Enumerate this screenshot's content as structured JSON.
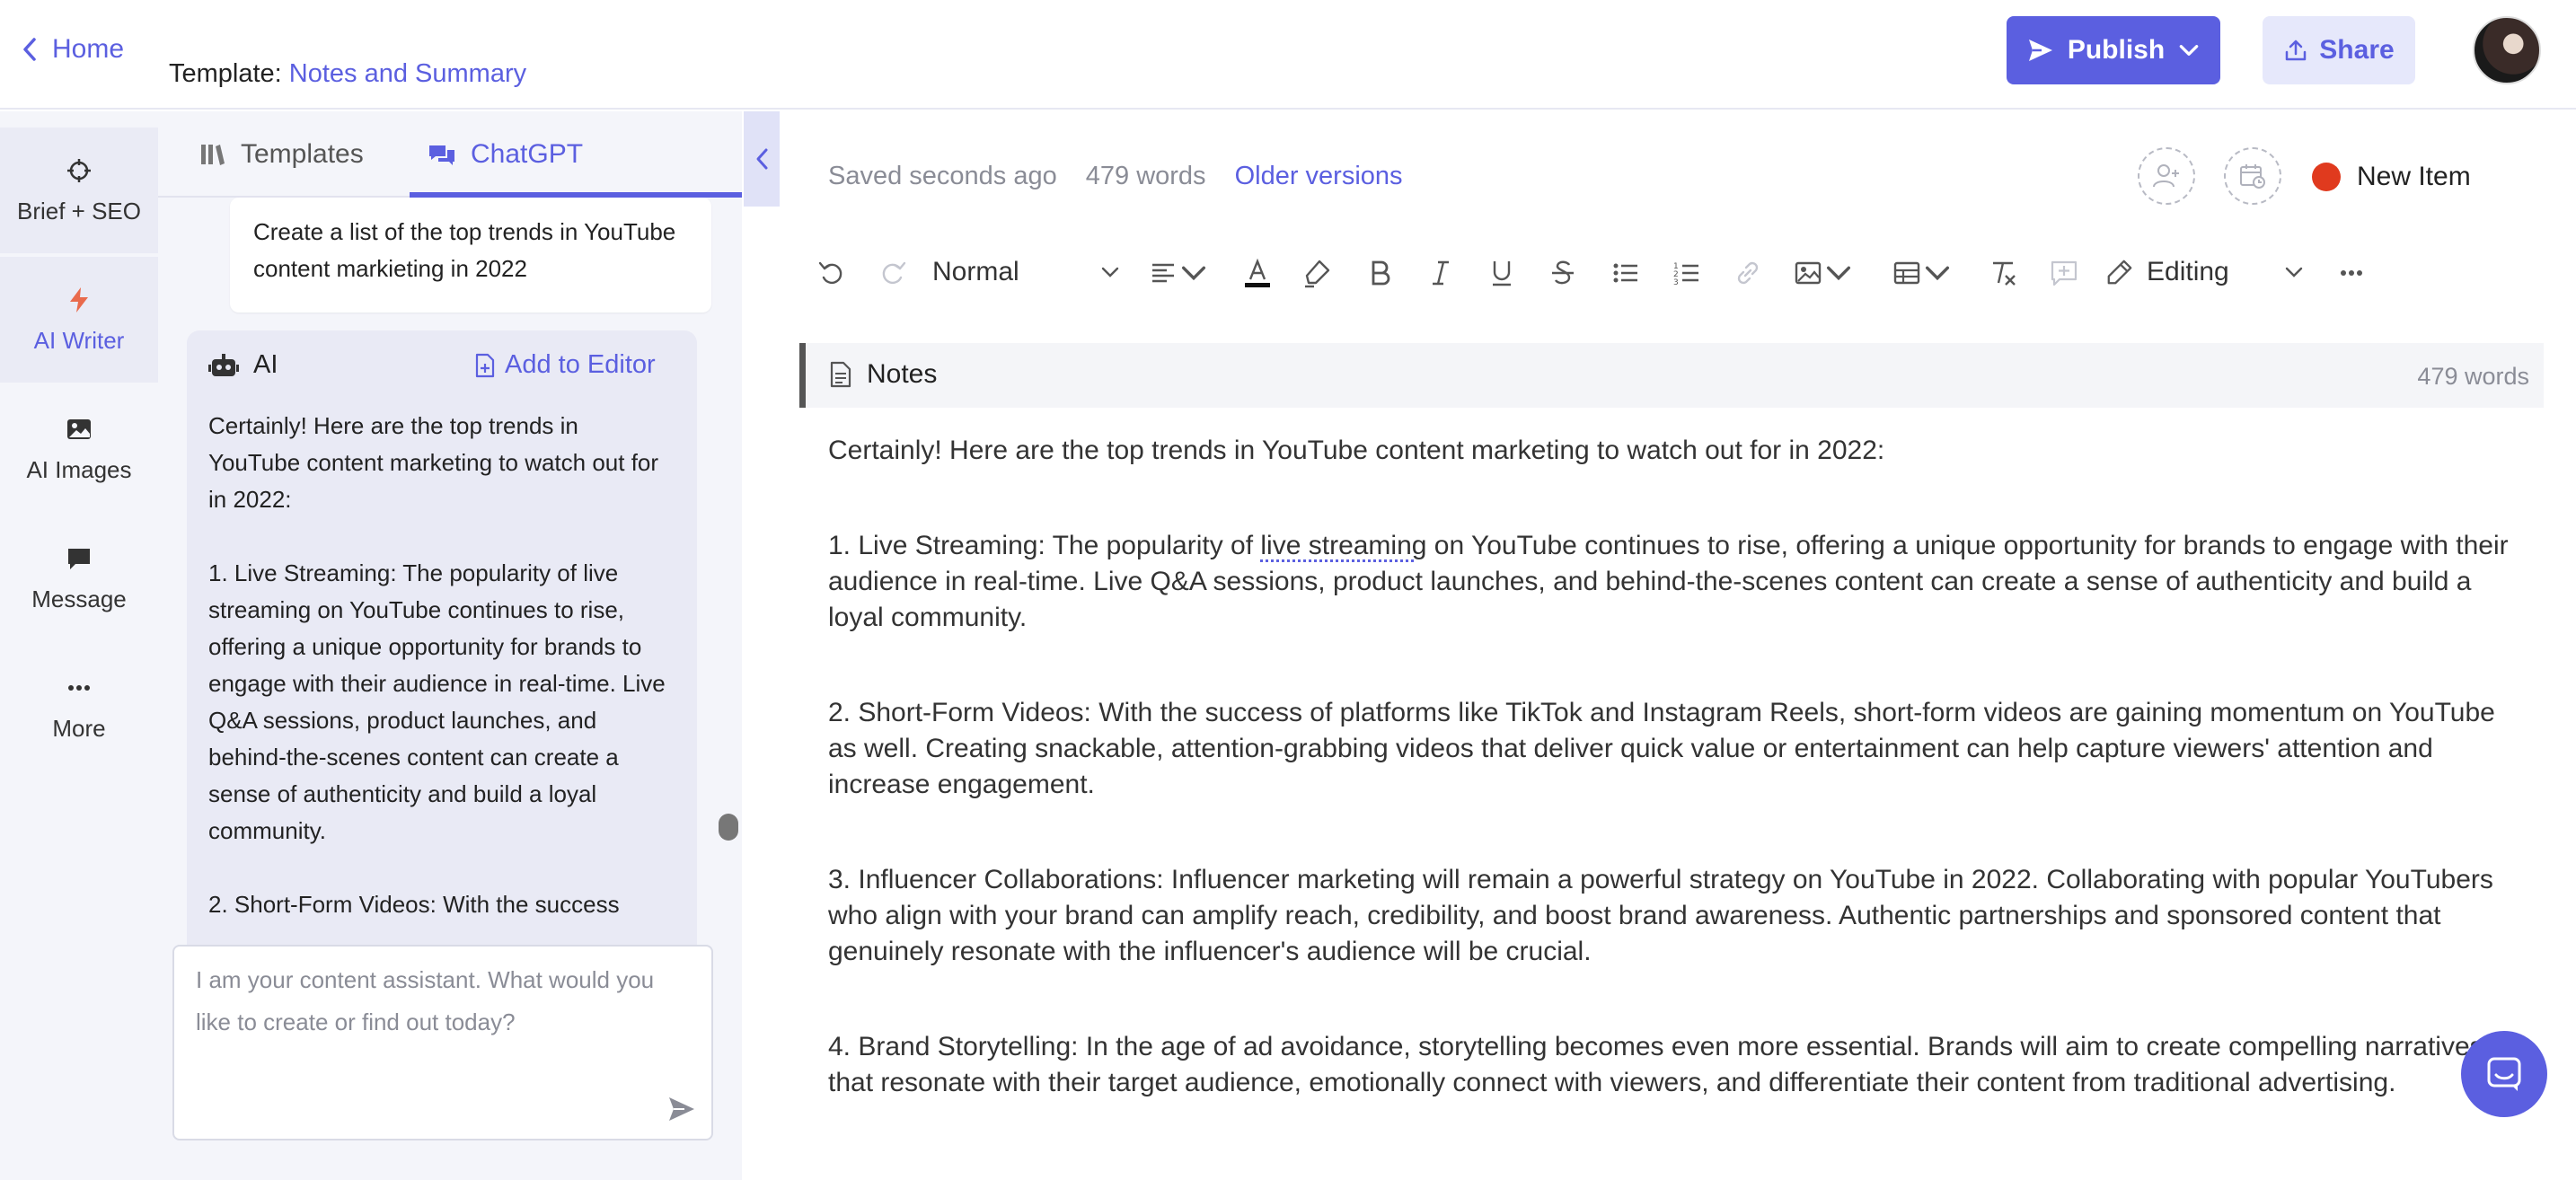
{
  "header": {
    "home_label": "Home",
    "template_prefix": "Template:",
    "template_name": "Notes and Summary",
    "publish_label": "Publish",
    "share_label": "Share"
  },
  "leftnav": {
    "items": [
      {
        "label": "Brief + SEO",
        "icon": "crosshair-icon"
      },
      {
        "label": "AI Writer",
        "icon": "bolt-icon"
      },
      {
        "label": "AI Images",
        "icon": "image-icon"
      },
      {
        "label": "Message",
        "icon": "chat-bubble-icon"
      },
      {
        "label": "More",
        "icon": "ellipsis-icon"
      }
    ]
  },
  "chat": {
    "tabs": [
      {
        "label": "Templates",
        "icon": "library-icon"
      },
      {
        "label": "ChatGPT",
        "icon": "chat-icon"
      }
    ],
    "user_message": "Create a list of the top trends in YouTube content markieting in 2022",
    "ai_label": "AI",
    "add_to_editor": "Add to Editor",
    "ai_response": "Certainly! Here are the top trends in YouTube content marketing to watch out for in 2022:\n\n1. Live Streaming: The popularity of live streaming on YouTube continues to rise, offering a unique opportunity for brands to engage with their audience in real-time. Live Q&A sessions, product launches, and behind-the-scenes content can create a sense of authenticity and build a loyal community.\n\n2. Short-Form Videos: With the success",
    "input_placeholder": "I am your content assistant. What would you like to create or find out today?"
  },
  "editor": {
    "saved_status": "Saved seconds ago",
    "word_count": "479 words",
    "older_versions": "Older versions",
    "item_status": "New Item",
    "status_color": "#e03a1e",
    "text_style": "Normal",
    "mode": "Editing",
    "section_title": "Notes",
    "section_word_count": "479 words",
    "paragraphs": {
      "intro": "Certainly! Here are the top trends in YouTube content marketing to watch out for in 2022:",
      "p1_before": "1. Live Streaming: The popularity of ",
      "p1_highlight": "live streaming",
      "p1_after": " on YouTube continues to rise, offering a unique opportunity for brands to engage with their audience in real-time. Live Q&A sessions, product launches, and behind-the-scenes content can create a sense of authenticity and build a loyal community.",
      "p2": "2. Short-Form Videos: With the success of platforms like TikTok and Instagram Reels, short-form videos are gaining momentum on YouTube as well. Creating snackable, attention-grabbing videos that deliver quick value or entertainment can help capture viewers' attention and increase engagement.",
      "p3": "3. Influencer Collaborations: Influencer marketing will remain a powerful strategy on YouTube in 2022. Collaborating with popular YouTubers who align with your brand can amplify reach, credibility, and boost brand awareness. Authentic partnerships and sponsored content that genuinely resonate with the influencer's audience will be crucial.",
      "p4": "4. Brand Storytelling: In the age of ad avoidance, storytelling becomes even more essential. Brands will aim to create compelling narratives that resonate with their target audience, emotionally connect with viewers, and differentiate their content from traditional advertising."
    }
  },
  "colors": {
    "accent": "#5b5fe0",
    "panel_bg": "#f4f5fa"
  }
}
